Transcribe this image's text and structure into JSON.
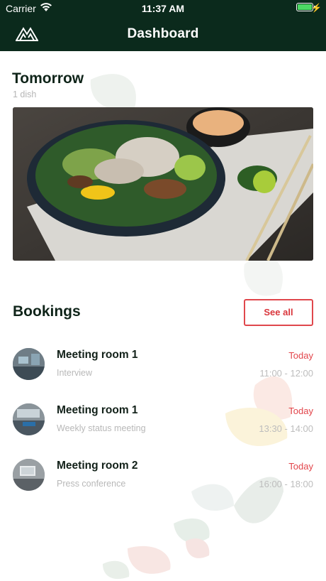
{
  "status_bar": {
    "carrier": "Carrier",
    "time": "11:37 AM"
  },
  "nav": {
    "title": "Dashboard",
    "logo_icon": "mountain-logo-icon"
  },
  "tomorrow": {
    "title": "Tomorrow",
    "subtitle": "1 dish"
  },
  "bookings": {
    "title": "Bookings",
    "see_all_label": "See all",
    "items": [
      {
        "room": "Meeting room 1",
        "description": "Interview",
        "day": "Today",
        "time": "11:00 - 12:00"
      },
      {
        "room": "Meeting room 1",
        "description": "Weekly status meeting",
        "day": "Today",
        "time": "13:30 - 14:00"
      },
      {
        "room": "Meeting room 2",
        "description": "Press conference",
        "day": "Today",
        "time": "16:00 - 18:00"
      }
    ]
  },
  "colors": {
    "header_bg": "#0b2a1c",
    "accent_red": "#e2454b",
    "battery_green": "#4cd964"
  }
}
